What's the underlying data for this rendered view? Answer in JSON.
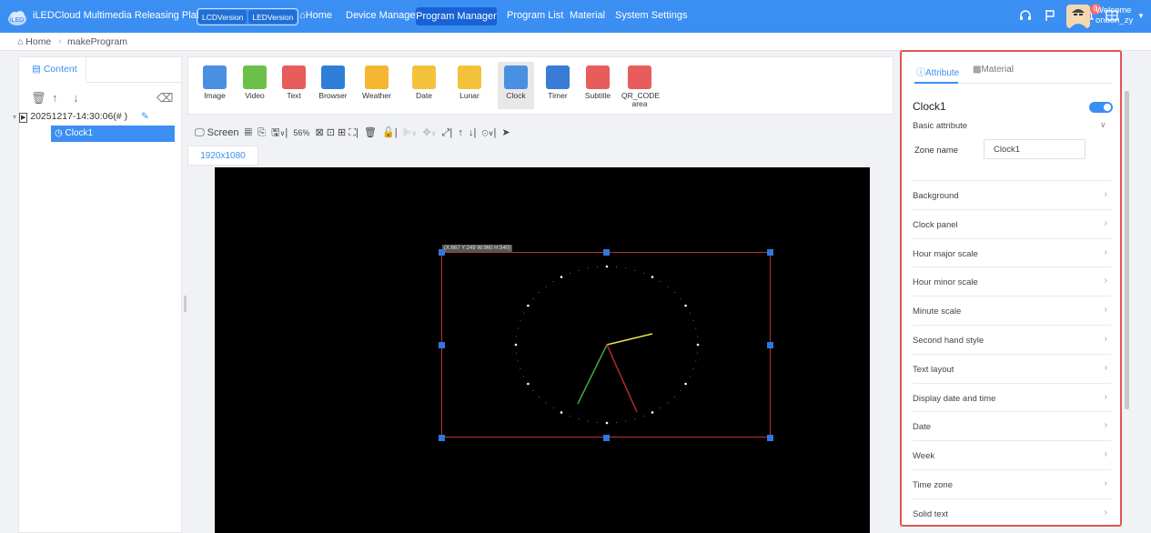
{
  "header": {
    "platform_title": "iLEDCloud Multimedia Releasing Platform",
    "version_lcd": "LCDVersion",
    "version_led": "LEDVersion",
    "nav": {
      "home": "Home",
      "device_manager": "Device Manager",
      "program_manager": "Program Manager",
      "program_list": "Program List",
      "material": "Material",
      "system_settings": "System Settings"
    },
    "notification_count": "0",
    "welcome": "Welcome",
    "username": "onbon_zy",
    "accent": "#3b8ff3"
  },
  "breadcrumb": {
    "home": "Home",
    "current": "makeProgram"
  },
  "left_panel": {
    "tab": "Content",
    "program_name": "20251217-14:30:06(# )",
    "zone_item": "Clock1"
  },
  "toolbox": [
    {
      "label": "Image",
      "icon": "image-icon",
      "color": "#4a90e2"
    },
    {
      "label": "Video",
      "icon": "video-icon",
      "color": "#6cc04a"
    },
    {
      "label": "Text",
      "icon": "text-icon",
      "color": "#e85c5c"
    },
    {
      "label": "Browser",
      "icon": "browser-icon",
      "color": "#2f7fd8"
    },
    {
      "label": "Weather",
      "icon": "weather-icon",
      "color": "#f5b731"
    },
    {
      "label": "Date",
      "icon": "date-icon",
      "color": "#f3c23a"
    },
    {
      "label": "Lunar",
      "icon": "lunar-icon",
      "color": "#f3c23a"
    },
    {
      "label": "Clock",
      "icon": "clock-icon",
      "color": "#4a90e2"
    },
    {
      "label": "Timer",
      "icon": "timer-icon",
      "color": "#3a7bd5"
    },
    {
      "label": "Subtitle",
      "icon": "subtitle-icon",
      "color": "#e85c5c"
    },
    {
      "label": "QR_CODE\narea",
      "icon": "qr-code-icon",
      "color": "#e85c5c"
    }
  ],
  "editor_toolbar": {
    "screen_label": "Screen",
    "zoom": "56%"
  },
  "resolution_tab": "1920x1080",
  "zone_info": "(X:667 Y:249 W:960 H:540)",
  "attribute_panel": {
    "tab_attribute": "Attribute",
    "tab_material": "Material",
    "zone_title": "Clock1",
    "basic_attribute": "Basic attribute",
    "zone_name_label": "Zone name",
    "zone_name_value": "Clock1",
    "sections": [
      "Background",
      "Clock panel",
      "Hour major scale",
      "Hour minor scale",
      "Minute scale",
      "Second hand style",
      "Text layout",
      "Display date and time",
      "Date",
      "Week",
      "Time zone",
      "Solid text"
    ]
  }
}
